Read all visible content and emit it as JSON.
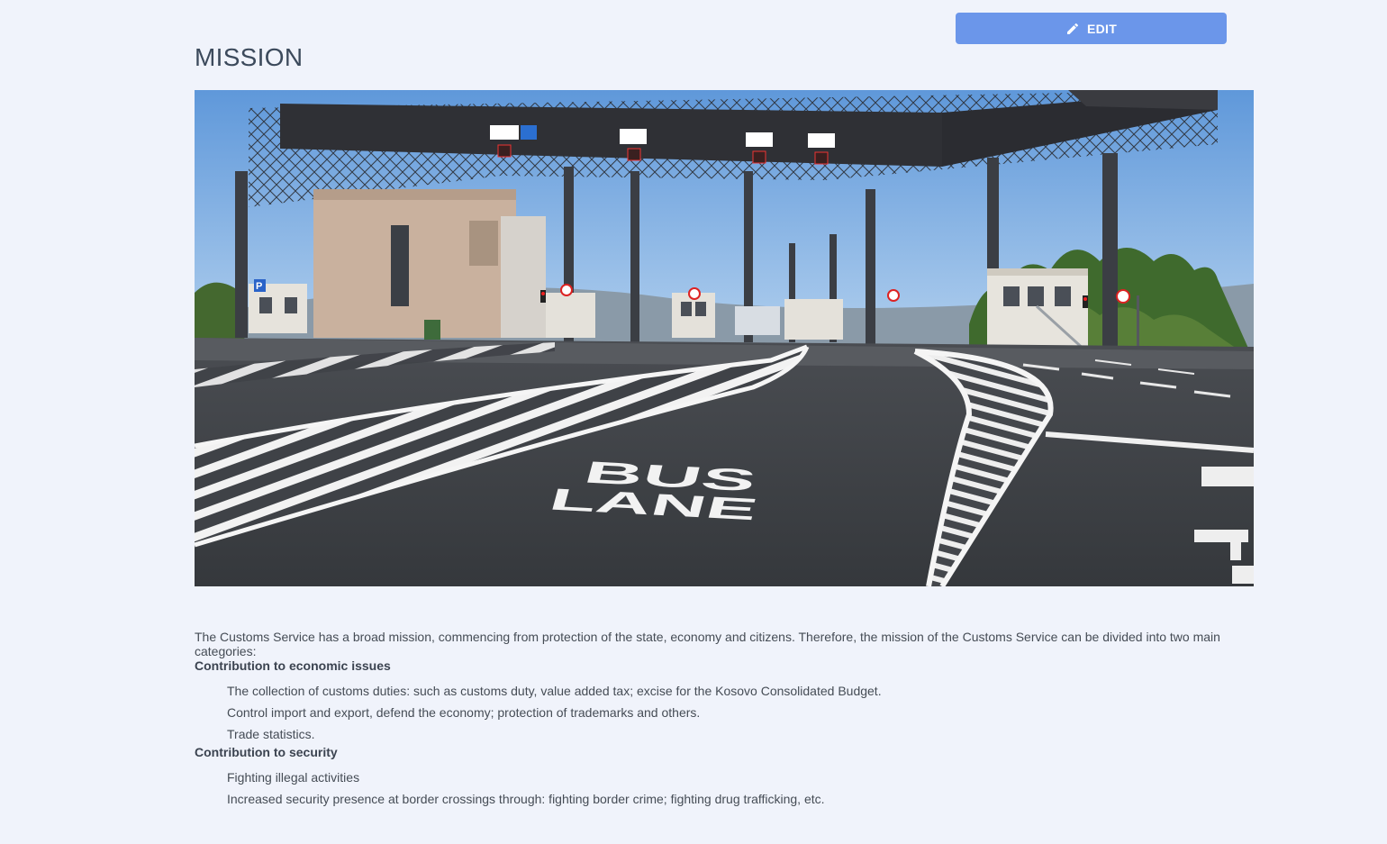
{
  "toolbar": {
    "edit_label": "EDIT"
  },
  "page": {
    "title": "MISSION"
  },
  "hero": {
    "road_text_line1": "BUS",
    "road_text_line2": "LANE",
    "parking_sign": "P"
  },
  "content": {
    "intro": "The Customs Service has a broad mission, commencing from protection of the state, economy and citizens. Therefore, the mission of the Customs Service can be divided into two main categories:",
    "sections": [
      {
        "heading": "Contribution to economic issues",
        "items": [
          "The collection of customs duties: such as customs duty, value added tax; excise for the Kosovo Consolidated Budget.",
          "Control import and export, defend the economy; protection of trademarks and others.",
          "Trade statistics."
        ]
      },
      {
        "heading": "Contribution to security",
        "items": [
          "Fighting illegal activities",
          "Increased security presence at border crossings through: fighting border crime; fighting drug trafficking, etc."
        ]
      }
    ]
  },
  "colors": {
    "accent": "#6b96ea",
    "background": "#f0f3fb"
  },
  "icons": {
    "edit": "pencil-icon"
  }
}
